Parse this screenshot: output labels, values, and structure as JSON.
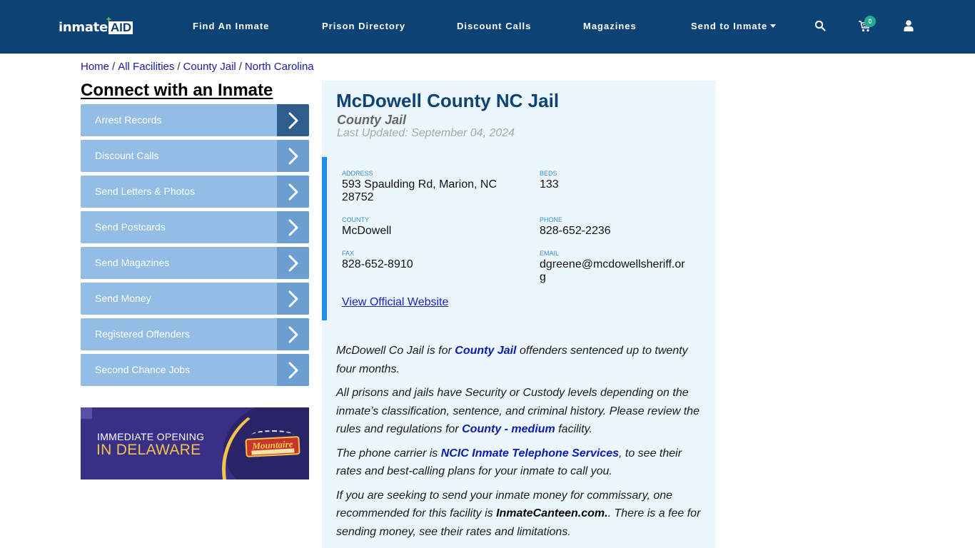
{
  "header": {
    "logo": {
      "part1": "inmate",
      "part2": "AID",
      "plus": "+"
    },
    "nav": [
      {
        "label": "Find An Inmate"
      },
      {
        "label": "Prison Directory"
      },
      {
        "label": "Discount Calls"
      },
      {
        "label": "Magazines"
      },
      {
        "label": "Send to Inmate",
        "has_dropdown": true
      }
    ],
    "icons": {
      "search": "search-icon",
      "cart": "cart-icon",
      "user": "user-icon"
    },
    "cart_count": "0"
  },
  "breadcrumb": {
    "items": [
      "Home",
      "All Facilities",
      "County Jail",
      "North Carolina"
    ],
    "separator": "/"
  },
  "sidebar": {
    "title": "Connect with an Inmate",
    "items": [
      {
        "label": "Arrest Records"
      },
      {
        "label": "Discount Calls"
      },
      {
        "label": "Send Letters & Photos"
      },
      {
        "label": "Send Postcards"
      },
      {
        "label": "Send Magazines"
      },
      {
        "label": "Send Money"
      },
      {
        "label": "Registered Offenders"
      },
      {
        "label": "Second Chance Jobs"
      }
    ],
    "ad": {
      "line1": "IMMEDIATE OPENING",
      "line2": "IN DELAWARE",
      "brand": "Mountaire"
    }
  },
  "facility": {
    "name": "McDowell County NC Jail",
    "type": "County Jail",
    "last_updated": "Last Updated: September 04, 2024",
    "fields": {
      "address": {
        "label": "ADDRESS",
        "value": "593 Spaulding Rd, Marion, NC 28752"
      },
      "beds": {
        "label": "BEDS",
        "value": "133"
      },
      "county": {
        "label": "COUNTY",
        "value": "McDowell"
      },
      "phone": {
        "label": "PHONE",
        "value": "828-652-2236"
      },
      "fax": {
        "label": "FAX",
        "value": "828-652-8910"
      },
      "email": {
        "label": "EMAIL",
        "value": "dgreene@mcdowellsheriff.org"
      }
    },
    "website_link": "View Official Website"
  },
  "description": {
    "p1": {
      "before": "McDowell Co Jail is for ",
      "link": "County Jail",
      "after": " offenders sentenced up to twenty four months."
    },
    "p2": {
      "before": "All prisons and jails have Security or Custody levels depending on the inmate’s classification, sentence, and criminal history. Please review the rules and regulations for ",
      "link": "County - medium",
      "after": " facility."
    },
    "p3": {
      "before": "The phone carrier is ",
      "link": "NCIC Inmate Telephone Services",
      "after": ", to see their rates and best-calling plans for your inmate to call you."
    },
    "p4": {
      "before": "If you are seeking to send your inmate money for commissary, one recommended for this facility is ",
      "bold": "InmateCanteen.com.",
      "after": ". There is a fee for sending money, see their rates and limitations."
    }
  },
  "colors": {
    "header_bg": "#0d4275",
    "sidebar_item": "#93bde5",
    "sidebar_arrow": "#6c9ecf",
    "sidebar_arrow_active": "#2f5d8c",
    "card_bg": "#ecf6fd",
    "accent_border": "#1f8cec",
    "link": "#0c1bb0",
    "badge": "#1fae8e"
  }
}
